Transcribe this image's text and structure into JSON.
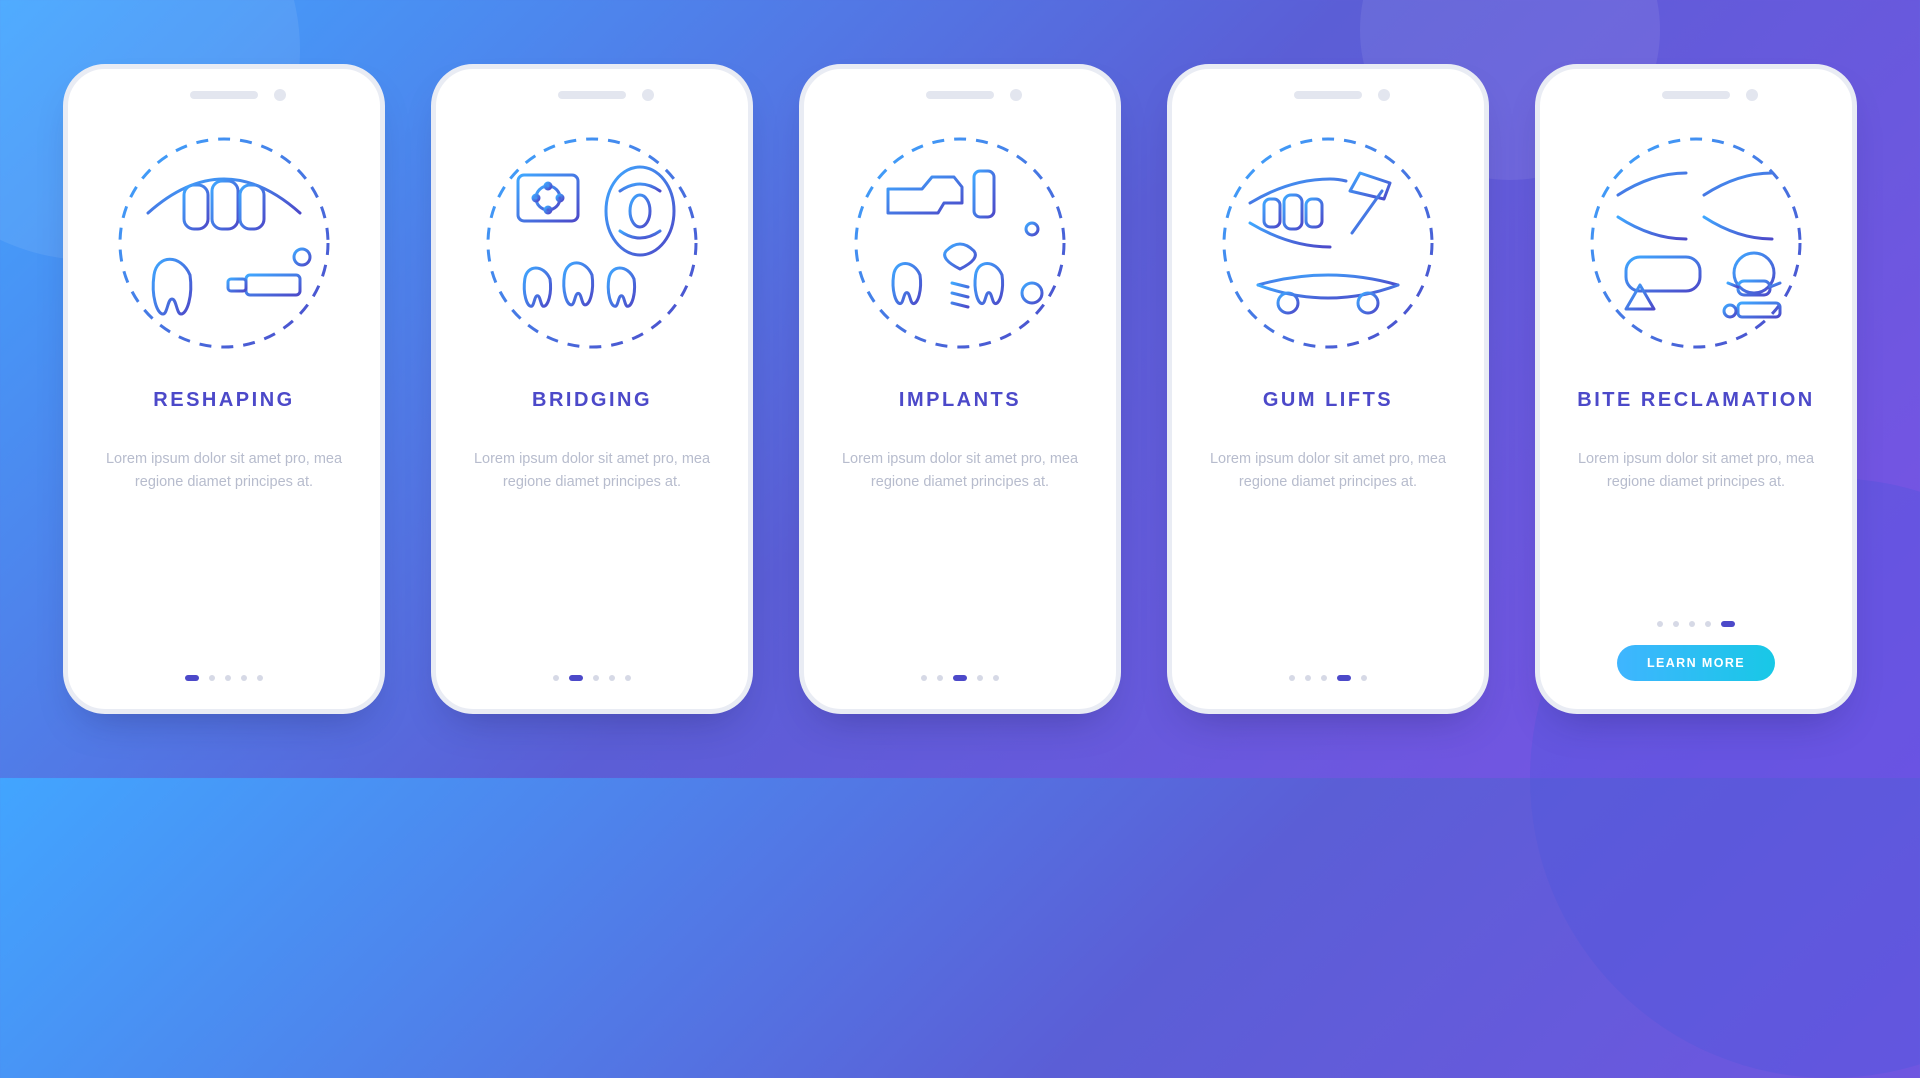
{
  "screens": [
    {
      "title": "RESHAPING",
      "description": "Lorem ipsum dolor sit amet pro, mea regione diamet principes at.",
      "icon_name": "reshaping-icon",
      "active_index": 0,
      "has_cta": false
    },
    {
      "title": "BRIDGING",
      "description": "Lorem ipsum dolor sit amet pro, mea regione diamet principes at.",
      "icon_name": "bridging-icon",
      "active_index": 1,
      "has_cta": false
    },
    {
      "title": "IMPLANTS",
      "description": "Lorem ipsum dolor sit amet pro, mea regione diamet principes at.",
      "icon_name": "implants-icon",
      "active_index": 2,
      "has_cta": false
    },
    {
      "title": "GUM LIFTS",
      "description": "Lorem ipsum dolor sit amet pro, mea regione diamet principes at.",
      "icon_name": "gum-lifts-icon",
      "active_index": 3,
      "has_cta": false
    },
    {
      "title": "BITE RECLAMATION",
      "description": "Lorem ipsum dolor sit amet pro, mea regione diamet principes at.",
      "icon_name": "bite-reclamation-icon",
      "active_index": 4,
      "has_cta": true
    }
  ],
  "total_dots": 5,
  "cta_label": "LEARN MORE",
  "colors": {
    "stroke_light": "#3fa8ff",
    "stroke_dark": "#4c49c9"
  }
}
